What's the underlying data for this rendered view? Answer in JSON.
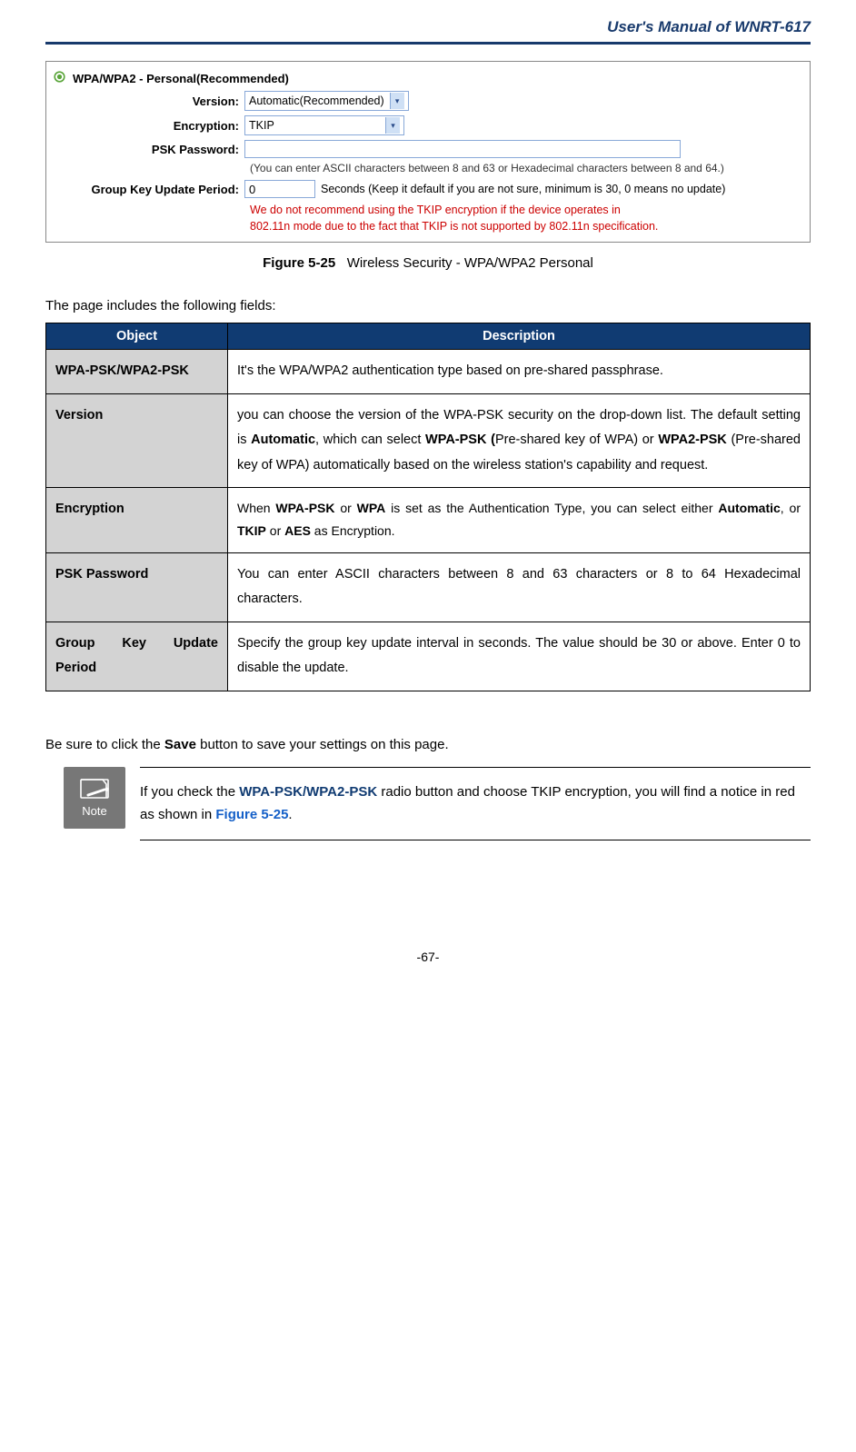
{
  "header": {
    "manual_title": "User's  Manual  of  WNRT-617"
  },
  "screenshot": {
    "radio_label": "WPA/WPA2 - Personal(Recommended)",
    "labels": {
      "version": "Version:",
      "encryption": "Encryption:",
      "psk": "PSK Password:",
      "group": "Group Key Update Period:"
    },
    "values": {
      "version": "Automatic(Recommended)",
      "encryption": "TKIP",
      "psk": "",
      "group": "0"
    },
    "hints": {
      "psk": "(You can enter ASCII characters between 8 and 63 or Hexadecimal characters between 8 and 64.)",
      "group_after": "Seconds (Keep it default if you are not sure, minimum is 30, 0 means no update)"
    },
    "warning": {
      "l1": "We do not recommend using the TKIP encryption if the device operates in",
      "l2": "802.11n mode due to the fact that TKIP is not supported by 802.11n specification."
    }
  },
  "figure": {
    "num": "Figure 5-25",
    "caption": "Wireless Security - WPA/WPA2 Personal"
  },
  "intro": "The page includes the following fields:",
  "table": {
    "head_object": "Object",
    "head_desc": "Description",
    "rows": [
      {
        "obj": "WPA-PSK/WPA2-PSK",
        "desc_html": "It's the WPA/WPA2 authentication type based on pre-shared passphrase."
      },
      {
        "obj": "Version",
        "desc_html": "you can choose the version of the WPA-PSK security on the drop-down list. The default setting is <b>Automatic</b>, which can select <b>WPA-PSK (</b>Pre-shared key of WPA) or <b>WPA2-PSK</b> (Pre-shared key of WPA) automatically based on the wireless station's capability and request."
      },
      {
        "obj": "Encryption",
        "desc_html": "When <b>WPA-PSK</b> or <b>WPA</b> is set as the Authentication Type, you can select either <b>Automatic</b>, or <b>TKIP</b> or <b>AES</b> as Encryption."
      },
      {
        "obj": "PSK Password",
        "desc_html": "You can enter ASCII characters between 8 and 63 characters or 8 to 64 Hexadecimal characters."
      },
      {
        "obj_html": "<span class=\"obj-wide\"><span>Group</span><span>Key</span><span>Update</span></span>Period",
        "desc_html": "Specify the group key update interval in seconds. The value should be 30 or above. Enter 0 to disable the update."
      }
    ]
  },
  "post_note_html": "Be sure to click the <b>Save</b> button to save your settings on this page.",
  "note": {
    "icon_label": "Note",
    "text_html": "If you check the <span class=\"bold-blue\">WPA-PSK/WPA2-PSK</span> radio button and choose TKIP encryption, you will find a notice in red as shown in <span class=\"ref-blue\">Figure 5-25</span>."
  },
  "footer_page": "-67-"
}
